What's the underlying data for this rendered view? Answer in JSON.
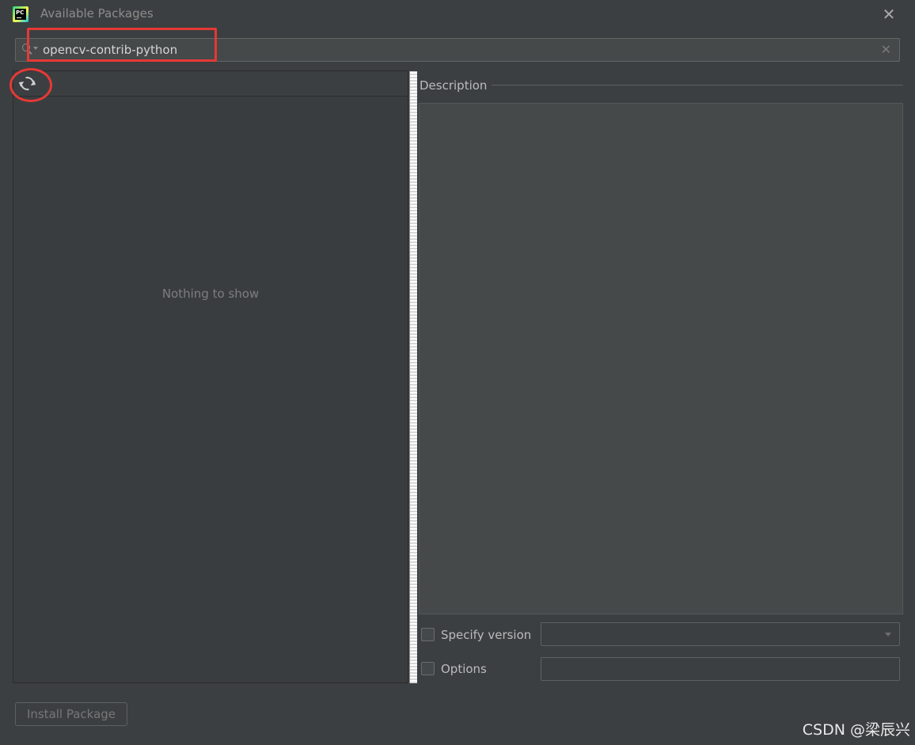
{
  "window": {
    "title": "Available Packages",
    "app_icon": "pycharm-icon",
    "close_label": "✕"
  },
  "search": {
    "value": "opencv-contrib-python",
    "icon": "search-icon",
    "clear_label": "✕"
  },
  "package_list": {
    "refresh_icon": "refresh-icon",
    "empty_text": "Nothing to show"
  },
  "description": {
    "label": "Description"
  },
  "options": {
    "specify_version_label": "Specify version",
    "specify_version_checked": false,
    "version_value": "",
    "options_label": "Options",
    "options_checked": false,
    "options_value": ""
  },
  "footer": {
    "install_label": "Install Package"
  },
  "watermark": "CSDN @梁辰兴",
  "colors": {
    "background": "#3c3f41",
    "annotation": "#e53935"
  }
}
